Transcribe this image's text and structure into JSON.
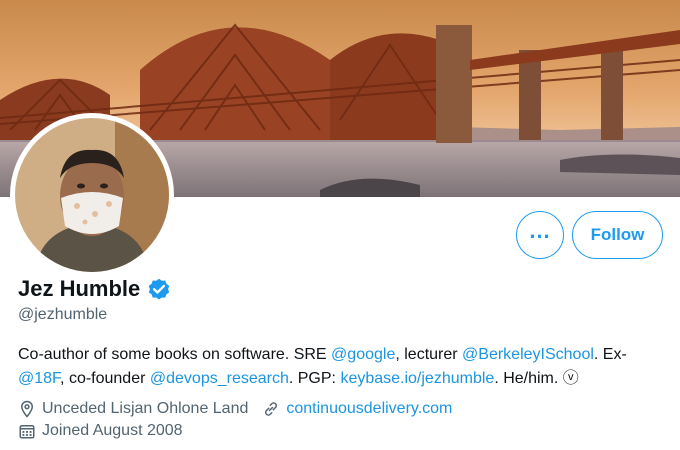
{
  "profile": {
    "display_name": "Jez Humble",
    "handle": "@jezhumble",
    "bio": {
      "t1": "Co-author of some books on software. SRE ",
      "l1": "@google",
      "t2": ", lecturer ",
      "l2": "@BerkeleyISchool",
      "t3": ". Ex-",
      "l3": "@18F",
      "t4": ", co-founder ",
      "l4": "@devops_research",
      "t5": ". PGP: ",
      "l5": "keybase.io/jezhumble",
      "t6": ". He/him. ",
      "t7": "ⓥ"
    },
    "location": "Unceded Lisjan Ohlone Land",
    "website": "continuousdelivery.com",
    "joined": "Joined August 2008"
  },
  "actions": {
    "more_label": "...",
    "follow_label": "Follow"
  },
  "colors": {
    "accent": "#1d9bf0",
    "link": "#1b95e0",
    "muted": "#536471"
  },
  "icons": {
    "verified": "verified-badge-icon",
    "location": "location-pin-icon",
    "link": "link-icon",
    "calendar": "calendar-icon"
  }
}
